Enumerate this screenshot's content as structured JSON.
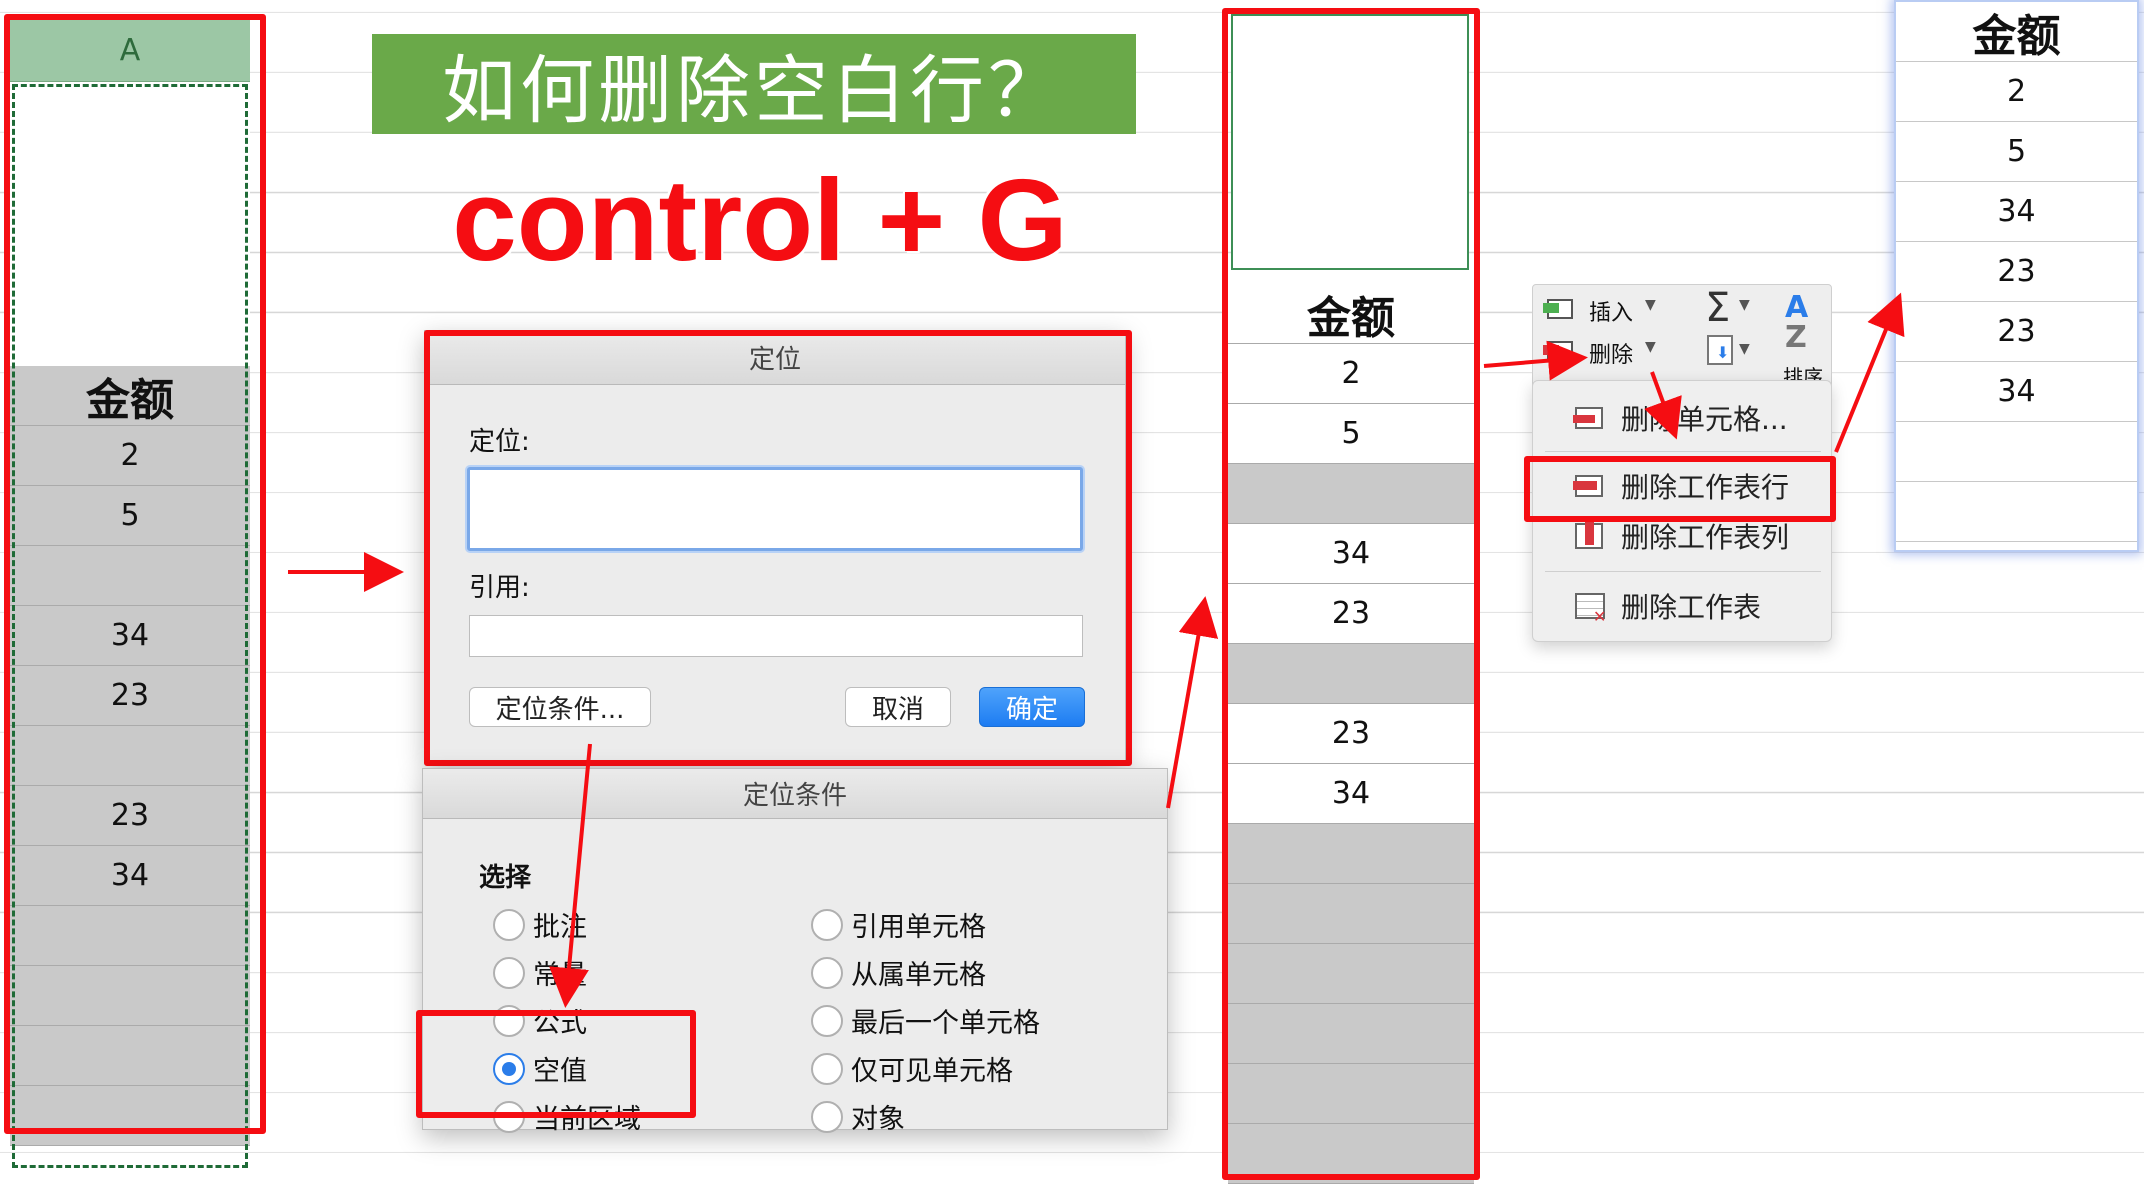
{
  "title": "如何删除空白行？",
  "shortcut": "control + G",
  "column_a": {
    "header": "A",
    "cells": [
      {
        "text": "金额",
        "style": "hdr"
      },
      {
        "text": "2",
        "style": "gray"
      },
      {
        "text": "5",
        "style": "gray"
      },
      {
        "text": "",
        "style": "gray"
      },
      {
        "text": "34",
        "style": "gray"
      },
      {
        "text": "23",
        "style": "gray"
      },
      {
        "text": "",
        "style": "gray"
      },
      {
        "text": "23",
        "style": "gray"
      },
      {
        "text": "34",
        "style": "gray"
      },
      {
        "text": "",
        "style": "gray"
      },
      {
        "text": "",
        "style": "gray"
      },
      {
        "text": "",
        "style": "gray"
      },
      {
        "text": "",
        "style": "gray"
      }
    ]
  },
  "goto_dialog": {
    "title": "定位",
    "goto_label": "定位:",
    "goto_value": "",
    "reference_label": "引用:",
    "reference_value": "",
    "special_button": "定位条件...",
    "cancel_button": "取消",
    "ok_button": "确定"
  },
  "special_dialog": {
    "title": "定位条件",
    "section_label": "选择",
    "options_left": [
      {
        "label": "批注",
        "selected": false
      },
      {
        "label": "常量",
        "selected": false
      },
      {
        "label": "公式",
        "selected": false
      },
      {
        "label": "空值",
        "selected": true
      },
      {
        "label": "当前区域",
        "selected": false
      }
    ],
    "options_right": [
      {
        "label": "引用单元格",
        "selected": false
      },
      {
        "label": "从属单元格",
        "selected": false
      },
      {
        "label": "最后一个单元格",
        "selected": false
      },
      {
        "label": "仅可见单元格",
        "selected": false
      },
      {
        "label": "对象",
        "selected": false
      }
    ]
  },
  "column_mid": {
    "cells": [
      {
        "text": "金额",
        "style": "hdr"
      },
      {
        "text": "2",
        "style": "white"
      },
      {
        "text": "5",
        "style": "white"
      },
      {
        "text": "",
        "style": "gray"
      },
      {
        "text": "34",
        "style": "white"
      },
      {
        "text": "23",
        "style": "white"
      },
      {
        "text": "",
        "style": "gray"
      },
      {
        "text": "23",
        "style": "white"
      },
      {
        "text": "34",
        "style": "white"
      },
      {
        "text": "",
        "style": "gray"
      },
      {
        "text": "",
        "style": "gray"
      },
      {
        "text": "",
        "style": "gray"
      },
      {
        "text": "",
        "style": "gray"
      },
      {
        "text": "",
        "style": "gray"
      },
      {
        "text": "",
        "style": "gray"
      }
    ]
  },
  "ribbon": {
    "insert_label": "插入",
    "delete_label": "删除",
    "sort_label": "排序",
    "sum_symbol": "Σ"
  },
  "delete_menu": {
    "items": [
      "删除单元格...",
      "删除工作表行",
      "删除工作表列",
      "删除工作表"
    ],
    "highlighted": "删除工作表行"
  },
  "column_result": {
    "cells": [
      {
        "text": "金额",
        "style": "hdr"
      },
      {
        "text": "2",
        "style": "white"
      },
      {
        "text": "5",
        "style": "white"
      },
      {
        "text": "34",
        "style": "white"
      },
      {
        "text": "23",
        "style": "white"
      },
      {
        "text": "23",
        "style": "white"
      },
      {
        "text": "34",
        "style": "white"
      },
      {
        "text": "",
        "style": "white"
      },
      {
        "text": "",
        "style": "white"
      }
    ]
  },
  "colors": {
    "highlight_red": "#f50d12",
    "title_green": "#6aa949",
    "header_green": "#9cc7a5",
    "selected_gray": "#c9c9c9",
    "primary_blue": "#1d7cf2"
  }
}
